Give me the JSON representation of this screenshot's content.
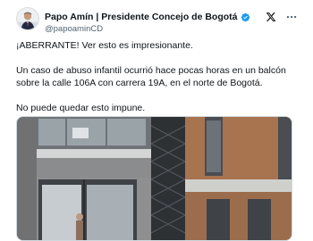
{
  "tweet": {
    "author_name": "Papo Amín | Presidente Concejo de Bogotá",
    "handle": "@papoaminCD",
    "paragraphs": [
      "¡ABERRANTE! Ver esto es impresionante.",
      "Un caso de abuso infantil ocurrió hace pocas horas en un balcón sobre la calle 106A con carrera 19A, en el norte de Bogotá.",
      "No puede quedar esto impune."
    ]
  },
  "icons": {
    "avatar": "avatar-photo",
    "verified": "verified-badge-icon",
    "platform": "x-logo-icon",
    "menu": "more-options-icon"
  },
  "colors": {
    "text": "#0f1419",
    "secondary": "#536471",
    "verified": "#1d9bf0",
    "media_border": "#cfd9de"
  }
}
